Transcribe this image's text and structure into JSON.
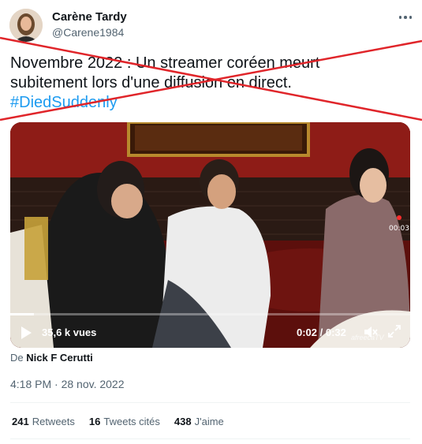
{
  "tweet": {
    "author_name": "Carène Tardy",
    "author_handle": "@Carene1984",
    "text_line1": "Novembre 2022 : Un streamer coréen meurt",
    "text_line2": "subitement lors d'une diffusion en direct.",
    "hashtag": "#DiedSuddenly",
    "timestamp": "4:18 PM · 28 nov. 2022",
    "source_prefix": "De",
    "source_name": "Nick F Cerutti"
  },
  "video": {
    "views": "35,6 k vues",
    "time": "0:02 / 0:32",
    "badge_time": "00:03",
    "watermark": "afreecaTV",
    "progress_fraction": 0.06
  },
  "stats": {
    "retweets_count": "241",
    "retweets_label": "Retweets",
    "quotes_count": "16",
    "quotes_label": "Tweets cités",
    "likes_count": "438",
    "likes_label": "J'aime"
  },
  "colors": {
    "accent": "#1d9bf0",
    "cross": "#e0252a"
  },
  "icons": [
    "more-icon",
    "play-icon",
    "mute-icon",
    "fullscreen-icon"
  ]
}
